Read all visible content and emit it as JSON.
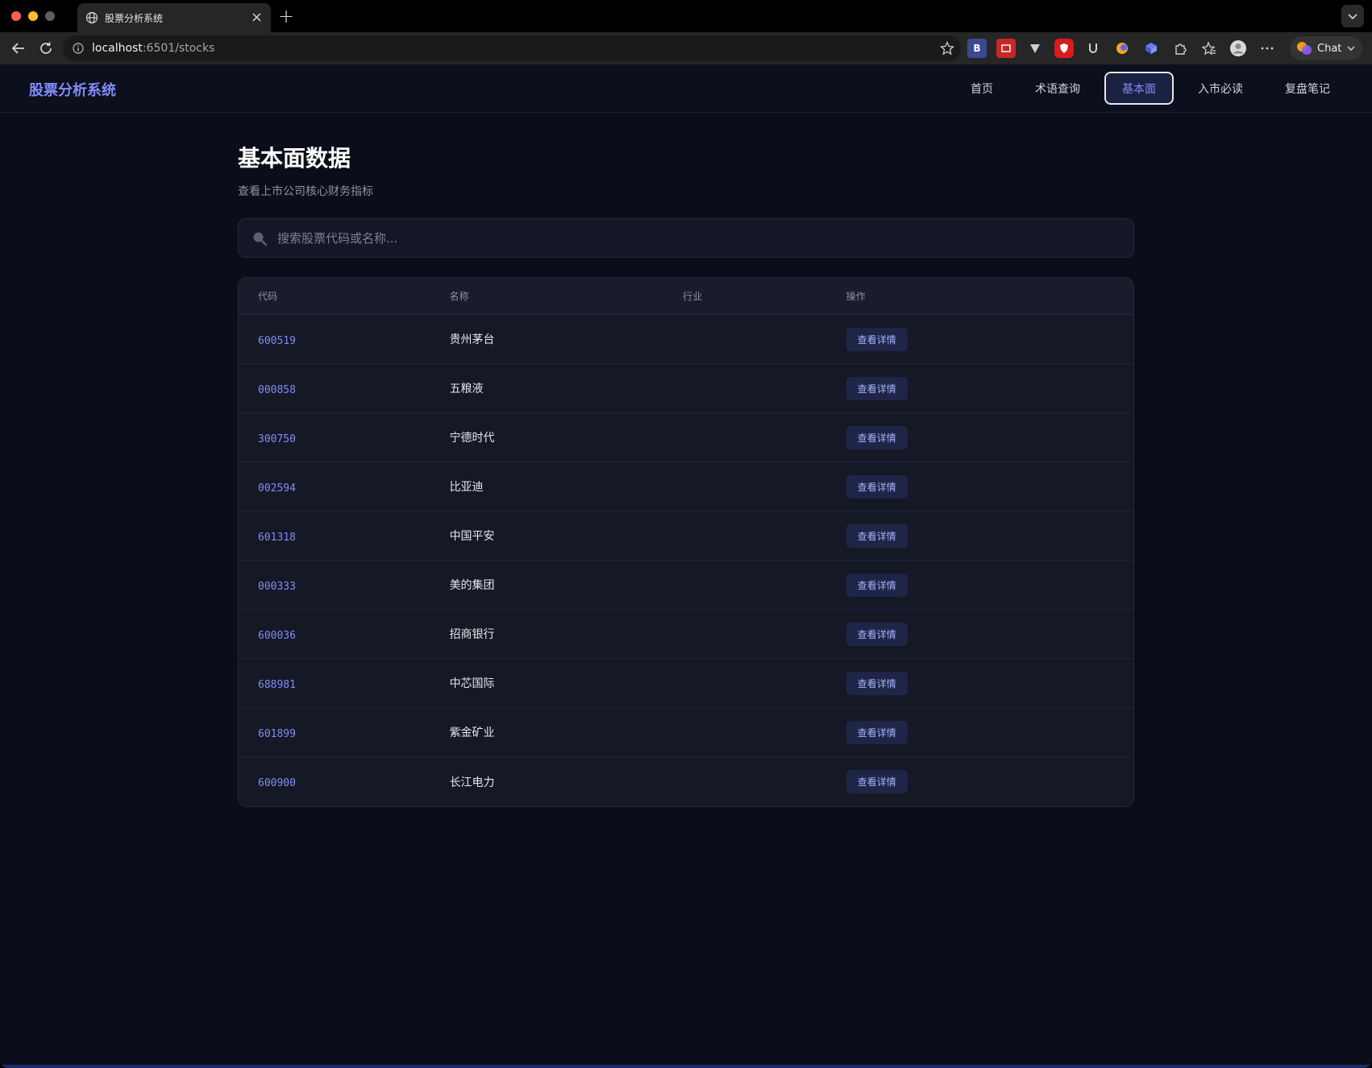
{
  "browser": {
    "tab_title": "股票分析系统",
    "url_host": "localhost",
    "url_rest": ":6501/stocks",
    "chat_label": "Chat",
    "ext_b_label": "B"
  },
  "header": {
    "brand": "股票分析系统",
    "nav": [
      {
        "label": "首页"
      },
      {
        "label": "术语查询"
      },
      {
        "label": "基本面",
        "active": true
      },
      {
        "label": "入市必读"
      },
      {
        "label": "复盘笔记"
      }
    ]
  },
  "main": {
    "title": "基本面数据",
    "subtitle": "查看上市公司核心财务指标",
    "search": {
      "placeholder": "搜索股票代码或名称...",
      "value": ""
    },
    "table": {
      "headers": [
        "代码",
        "名称",
        "行业",
        "操作"
      ],
      "rows": [
        {
          "code": "600519",
          "name": "贵州茅台",
          "industry": "",
          "action": "查看详情"
        },
        {
          "code": "000858",
          "name": "五粮液",
          "industry": "",
          "action": "查看详情"
        },
        {
          "code": "300750",
          "name": "宁德时代",
          "industry": "",
          "action": "查看详情"
        },
        {
          "code": "002594",
          "name": "比亚迪",
          "industry": "",
          "action": "查看详情"
        },
        {
          "code": "601318",
          "name": "中国平安",
          "industry": "",
          "action": "查看详情"
        },
        {
          "code": "000333",
          "name": "美的集团",
          "industry": "",
          "action": "查看详情"
        },
        {
          "code": "600036",
          "name": "招商银行",
          "industry": "",
          "action": "查看详情"
        },
        {
          "code": "688981",
          "name": "中芯国际",
          "industry": "",
          "action": "查看详情"
        },
        {
          "code": "601899",
          "name": "紫金矿业",
          "industry": "",
          "action": "查看详情"
        },
        {
          "code": "600900",
          "name": "长江电力",
          "industry": "",
          "action": "查看详情"
        }
      ]
    }
  },
  "colors": {
    "accent": "#818cf8",
    "background": "#0b0e1a",
    "table_bg": "#151926"
  }
}
